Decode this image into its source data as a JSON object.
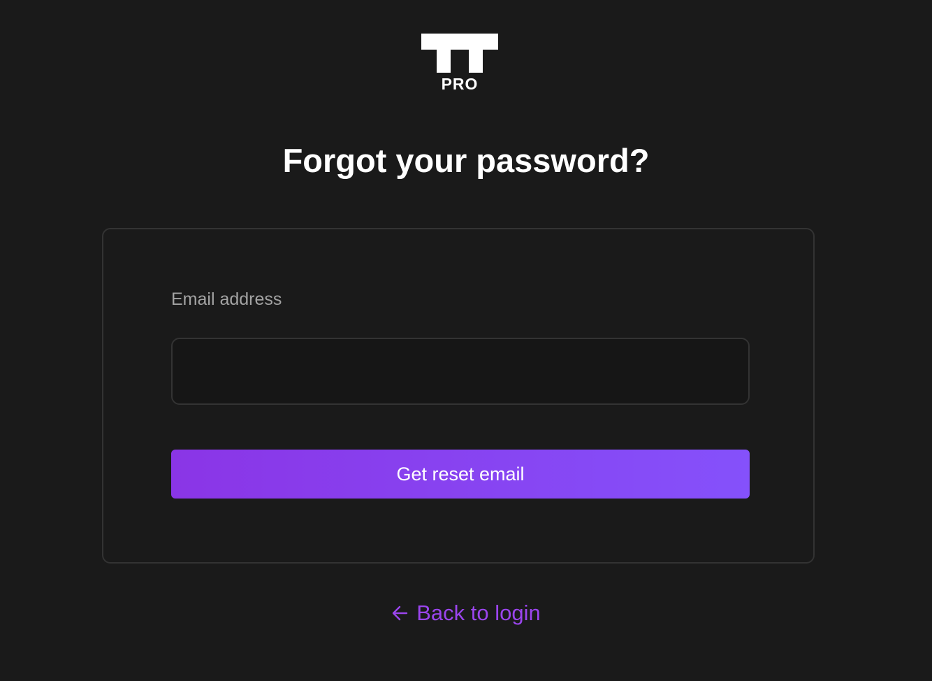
{
  "logo": {
    "icon": "tt-logo-icon",
    "text": "PRO"
  },
  "page": {
    "title": "Forgot your password?"
  },
  "form": {
    "email_label": "Email address",
    "email_value": "",
    "email_placeholder": "",
    "submit_label": "Get reset email"
  },
  "footer": {
    "back_icon": "arrow-left-icon",
    "back_label": "Back to login"
  },
  "colors": {
    "background": "#1a1a1a",
    "accent": "#8b3ff0",
    "accent_gradient_start": "#8a35e6",
    "accent_gradient_end": "#8551fb",
    "link": "#9b45ee",
    "border": "#333333",
    "label": "#a3a3a3"
  }
}
